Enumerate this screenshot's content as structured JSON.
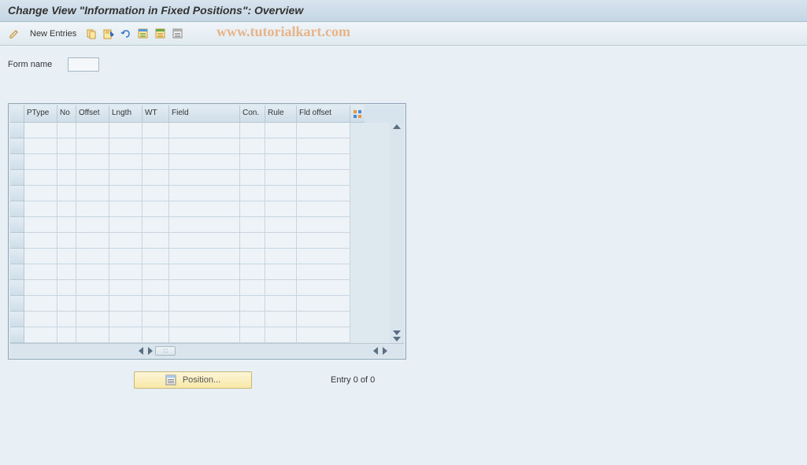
{
  "title": "Change View \"Information in Fixed Positions\": Overview",
  "toolbar": {
    "new_entries_label": "New Entries",
    "icons": {
      "pencil": "pencil-display-icon",
      "copy": "copy-icon",
      "delete": "delete-icon",
      "undo": "undo-icon",
      "select_all": "select-all-icon",
      "select_block": "select-block-icon",
      "deselect": "deselect-all-icon"
    }
  },
  "watermark": "www.tutorialkart.com",
  "form": {
    "form_name_label": "Form name",
    "form_name_value": ""
  },
  "table": {
    "columns": [
      {
        "key": "ptype",
        "label": "PType"
      },
      {
        "key": "no",
        "label": "No"
      },
      {
        "key": "offset",
        "label": "Offset"
      },
      {
        "key": "lngth",
        "label": "Lngth"
      },
      {
        "key": "wt",
        "label": "WT"
      },
      {
        "key": "field",
        "label": "Field"
      },
      {
        "key": "con",
        "label": "Con."
      },
      {
        "key": "rule",
        "label": "Rule"
      },
      {
        "key": "fldoffset",
        "label": "Fld offset"
      }
    ],
    "rows": [],
    "empty_row_count": 14
  },
  "footer": {
    "position_button_label": "Position...",
    "entry_status": "Entry 0 of 0"
  }
}
